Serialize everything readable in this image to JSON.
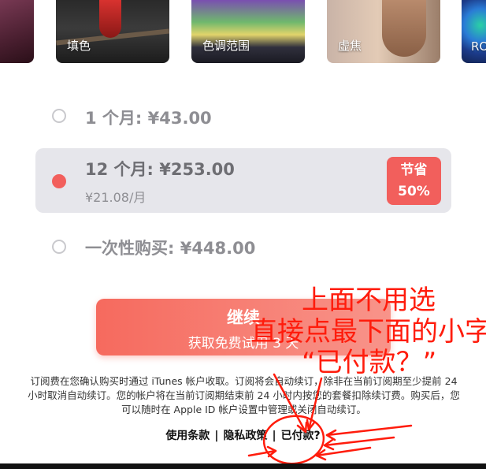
{
  "filters": [
    {
      "id": "portrait",
      "label": ""
    },
    {
      "id": "fill",
      "label": "填色"
    },
    {
      "id": "tone",
      "label": "色调范围"
    },
    {
      "id": "blur",
      "label": "虚焦"
    },
    {
      "id": "ro",
      "label": "RO"
    }
  ],
  "plans": [
    {
      "label": "1 个月: ¥43.00",
      "selected": false
    },
    {
      "label": "12 个月: ¥253.00",
      "sub": "¥21.08/月",
      "selected": true,
      "badge_line1": "节省",
      "badge_line2": "50%"
    },
    {
      "label": "一次性购买: ¥448.00",
      "selected": false
    }
  ],
  "cta": {
    "main": "继续",
    "sub": "获取免费试用 3 天"
  },
  "legal_text": "订阅费在您确认购买时通过 iTunes 帐户收取。订阅将会自动续订，除非在当前订阅期至少提前 24 小时取消自动续订。您的帐户将在当前订阅期结束前 24 小时内按您的套餐扣除续订费。购买后，您可以随时在 Apple ID 帐户设置中管理或关闭自动续订。",
  "links": {
    "terms": "使用条款",
    "privacy": "隐私政策",
    "paid": "已付款?",
    "separator": "|"
  },
  "annotation": {
    "line1": "上面不用选",
    "line2": "直接点最下面的小字",
    "line3": "“已付款？”",
    "color": "#ff1c0c"
  },
  "colors": {
    "accent": "#f25f5c",
    "card_bg": "#e6e6eb",
    "muted_text": "#8e8e93"
  }
}
